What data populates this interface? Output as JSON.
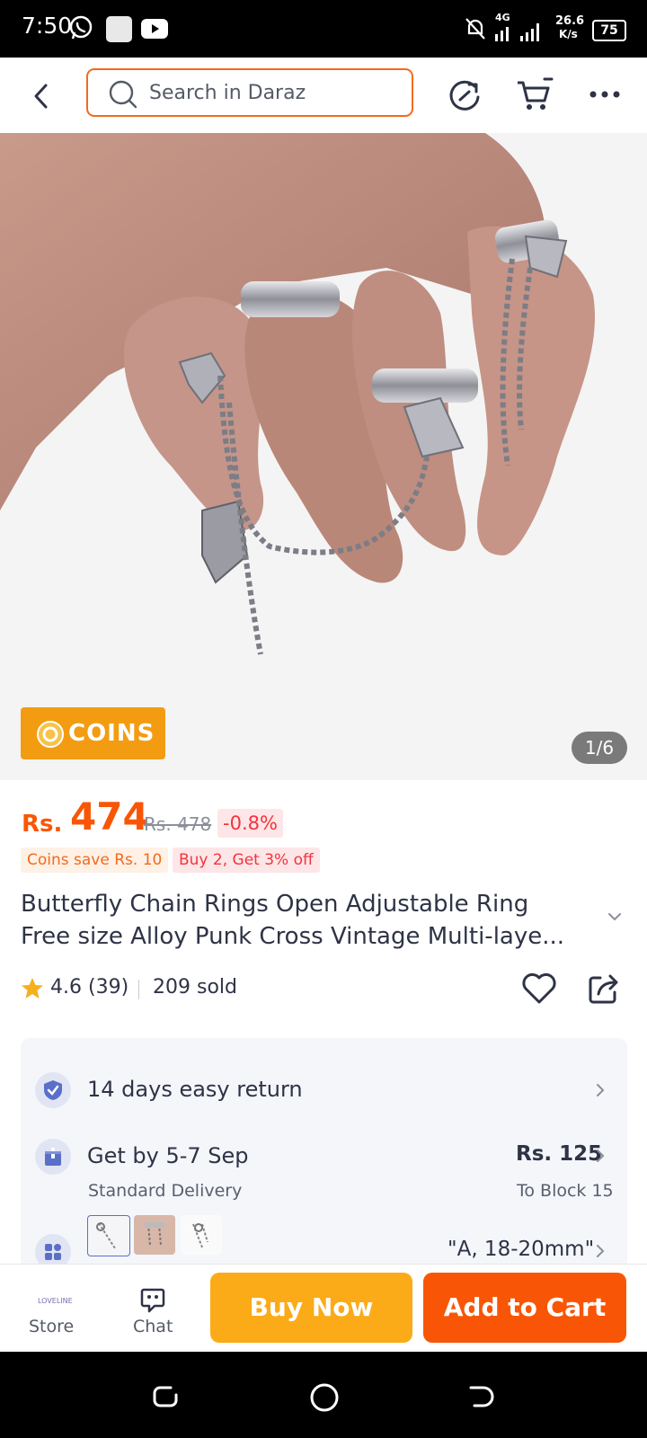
{
  "status_bar": {
    "time": "7:50",
    "network": "4G",
    "speed": "26.6",
    "speed_unit": "K/s",
    "battery": "75"
  },
  "header": {
    "search_placeholder": "Search in Daraz"
  },
  "hero": {
    "coins_label": "COINS",
    "image_counter": "1/6"
  },
  "price": {
    "currency": "Rs.",
    "amount": "474",
    "original": "Rs. 478",
    "discount": "-0.8%"
  },
  "promos": [
    "Coins save Rs. 10",
    "Buy 2, Get 3% off"
  ],
  "product": {
    "title_line1": "Butterfly Chain Rings Open Adjustable Ring",
    "title_line2": "Free size Alloy Punk Cross Vintage Multi-laye...",
    "rating": "4.6",
    "reviews": "(39)",
    "sold": "209 sold"
  },
  "info": {
    "return": "14 days easy return",
    "delivery": "Get by 5-7 Sep",
    "delivery_type": "Standard Delivery",
    "delivery_fee": "Rs. 125",
    "delivery_to": "To Block 15",
    "variant": "\"A, 18-20mm\""
  },
  "bottom": {
    "store_logo": "LOVELINE",
    "store": "Store",
    "chat": "Chat",
    "buy_now": "Buy Now",
    "add_to_cart": "Add to Cart"
  },
  "colors": {
    "brand": "#f85606",
    "buy_now": "#fbab18",
    "coins": "#f39c12"
  }
}
